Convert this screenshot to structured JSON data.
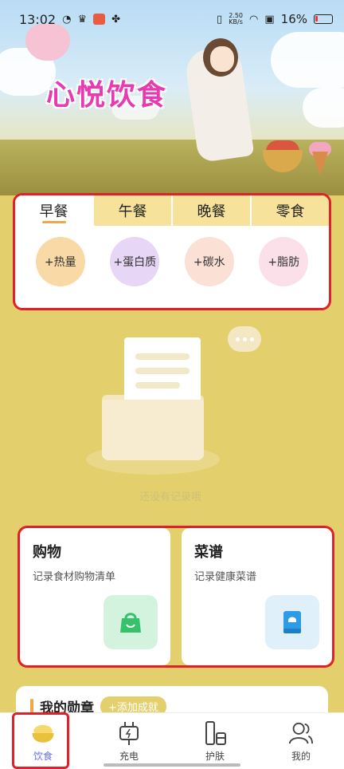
{
  "status": {
    "time": "13:02",
    "netspeed_value": "2.50",
    "netspeed_unit": "KB/s",
    "battery": "16%"
  },
  "hero": {
    "title": "心悦饮食"
  },
  "meal_tabs": [
    {
      "label": "早餐",
      "active": true
    },
    {
      "label": "午餐",
      "active": false
    },
    {
      "label": "晚餐",
      "active": false
    },
    {
      "label": "零食",
      "active": false
    }
  ],
  "nutrients": [
    {
      "label": "+热量",
      "color": "#f9d9a6"
    },
    {
      "label": "+蛋白质",
      "color": "#e7d6f6"
    },
    {
      "label": "+碳水",
      "color": "#fbe0d6"
    },
    {
      "label": "+脂肪",
      "color": "#fbe0ea"
    }
  ],
  "empty_state": {
    "text": "还没有记录哦"
  },
  "features": [
    {
      "title": "购物",
      "subtitle": "记录食材购物清单",
      "icon": "shopping-bag-icon",
      "icon_bg": "#d4f3df",
      "icon_color": "#36c26b"
    },
    {
      "title": "菜谱",
      "subtitle": "记录健康菜谱",
      "icon": "recipe-book-icon",
      "icon_bg": "#dff0fb",
      "icon_color": "#2e9be6"
    }
  ],
  "achievements": {
    "title": "我的勋章",
    "add_label": "+添加成就"
  },
  "nav": [
    {
      "label": "饮食",
      "icon": "rice-bowl-icon",
      "active": true
    },
    {
      "label": "充电",
      "icon": "plug-icon",
      "active": false
    },
    {
      "label": "护肤",
      "icon": "skincare-icon",
      "active": false
    },
    {
      "label": "我的",
      "icon": "user-icon",
      "active": false
    }
  ]
}
